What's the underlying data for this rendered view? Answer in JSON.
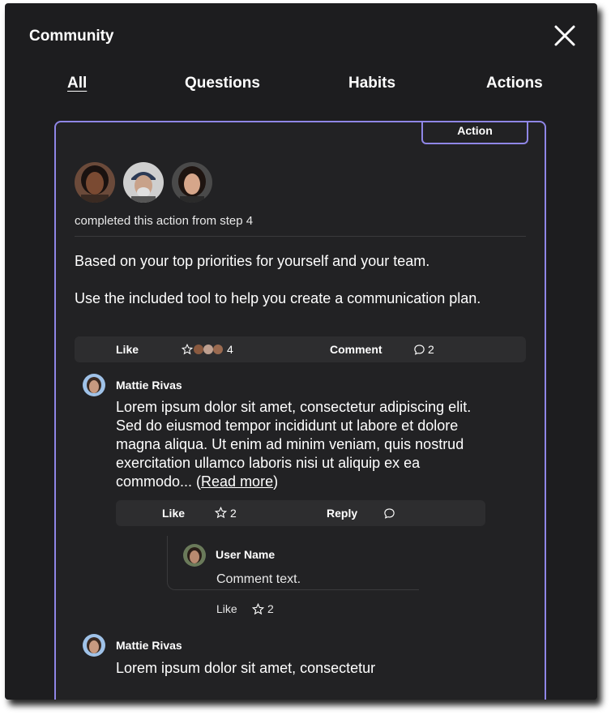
{
  "modal": {
    "title": "Community"
  },
  "tabs": [
    {
      "label": "All",
      "active": true
    },
    {
      "label": "Questions",
      "active": false
    },
    {
      "label": "Habits",
      "active": false
    },
    {
      "label": "Actions",
      "active": false
    }
  ],
  "post": {
    "badge": "Action",
    "completed_text": "completed this action from step 4",
    "paragraph1": "Based on your top priorities for yourself and your team.",
    "paragraph2": "Use the included tool to help you create a communication plan.",
    "actions": {
      "like_label": "Like",
      "like_count": "4",
      "comment_label": "Comment",
      "comment_count": "2"
    }
  },
  "comments": [
    {
      "author": "Mattie Rivas",
      "text": "Lorem ipsum dolor sit amet, consectetur adipiscing elit. Sed do eiusmod tempor incididunt ut labore et dolore magna aliqua. Ut enim ad minim veniam, quis nostrud exercitation ullamco laboris nisi ut aliquip ex ea commodo... (",
      "read_more": "Read more",
      "close_paren": ")",
      "like_label": "Like",
      "like_count": "2",
      "reply_label": "Reply",
      "reply": {
        "author": "User Name",
        "text": "Comment text.",
        "like_label": "Like",
        "like_count": "2"
      }
    },
    {
      "author": "Mattie Rivas",
      "text": "Lorem ipsum dolor sit amet, consectetur"
    }
  ],
  "colors": {
    "accent": "#8f86e6",
    "background": "#1d1d1f",
    "card": "#222224",
    "bar": "#2d2d2f"
  },
  "icons": [
    "close-icon",
    "star-icon",
    "speech-bubble-icon"
  ]
}
